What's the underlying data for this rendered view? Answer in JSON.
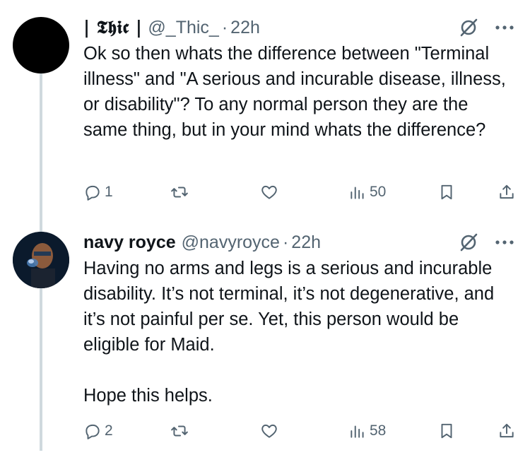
{
  "tweets": [
    {
      "name": "| 𝕿𝖍𝖎𝖈 |",
      "handle": "@_Thic_",
      "separator": "·",
      "time": "22h",
      "text": "Ok so then whats the difference between \"Terminal illness\" and \"A serious and incurable disease, illness, or disability\"? To any normal person they are the same thing, but in your mind whats the difference?",
      "replies": "1",
      "views": "50"
    },
    {
      "name": "navy royce",
      "handle": "@navyroyce",
      "separator": "·",
      "time": "22h",
      "text": "Having no arms and legs is a serious and incurable disability. It’s not terminal, it’s not degenerative, and it’s not painful per se. Yet, this person would be eligible for Maid.\n\nHope this helps.",
      "replies": "2",
      "views": "58"
    }
  ],
  "icons": {
    "reply": "reply-icon",
    "retweet": "retweet-icon",
    "like": "like-icon",
    "views": "views-icon",
    "bookmark": "bookmark-icon",
    "share": "share-icon",
    "grok": "grok-icon",
    "more": "more-icon"
  },
  "colors": {
    "text": "#0f1419",
    "secondary": "#536471",
    "thread_line": "#cfd9de",
    "background": "#ffffff"
  }
}
